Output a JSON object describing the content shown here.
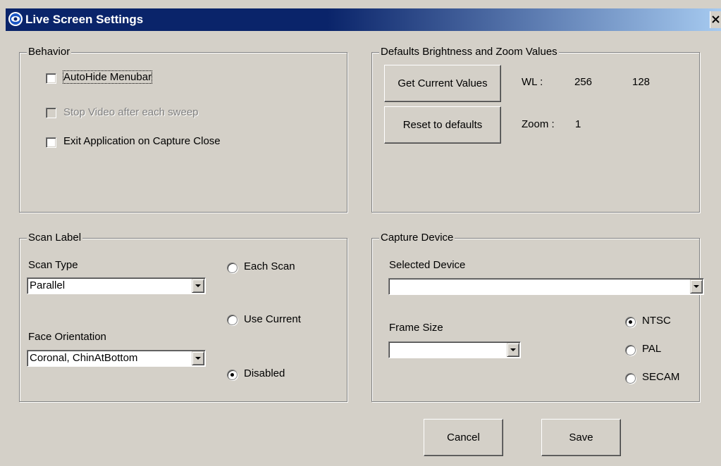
{
  "window": {
    "title": "Live Screen Settings"
  },
  "behavior": {
    "legend": "Behavior",
    "autohide_label": "AutoHide Menubar",
    "stop_video_label": "Stop Video after each sweep",
    "exit_app_label": "Exit Application on Capture Close"
  },
  "defaults": {
    "legend": "Defaults Brightness and Zoom Values",
    "get_current_label": "Get Current Values",
    "reset_label": "Reset to defaults",
    "wl_label": "WL :",
    "wl_value1": "256",
    "wl_value2": "128",
    "zoom_label": "Zoom :",
    "zoom_value": "1"
  },
  "scan_label": {
    "legend": "Scan Label",
    "scan_type_label": "Scan Type",
    "scan_type_value": "Parallel",
    "face_orientation_label": "Face Orientation",
    "face_orientation_value": "Coronal, ChinAtBottom",
    "radio_each_scan": "Each Scan",
    "radio_use_current": "Use Current",
    "radio_disabled": "Disabled",
    "selected_radio": "Disabled"
  },
  "capture": {
    "legend": "Capture Device",
    "selected_device_label": "Selected Device",
    "selected_device_value": "",
    "frame_size_label": "Frame Size",
    "frame_size_value": "",
    "radio_ntsc": "NTSC",
    "radio_pal": "PAL",
    "radio_secam": "SECAM",
    "selected_standard": "NTSC"
  },
  "footer": {
    "cancel_label": "Cancel",
    "save_label": "Save"
  }
}
